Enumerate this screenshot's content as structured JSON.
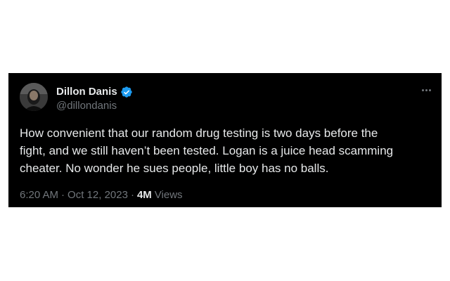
{
  "tweet": {
    "display_name": "Dillon Danis",
    "handle": "@dillondanis",
    "verified": true,
    "text": "How convenient that our random drug testing is two days before the\nfight, and we still haven’t been tested. Logan is a juice head scamming\ncheater. No wonder he sues people, little boy has no balls.",
    "time": "6:20 AM",
    "separator": "·",
    "date": "Oct 12, 2023",
    "views_count": "4M",
    "views_label": "Views"
  },
  "icons": {
    "verified": "verified-badge-icon",
    "more": "more-options-icon",
    "avatar": "profile-avatar"
  },
  "colors": {
    "card_background": "#000000",
    "text_primary": "#e7e9ea",
    "text_secondary": "#71767b",
    "verified_blue": "#1d9bf0",
    "page_background": "#ffffff"
  }
}
